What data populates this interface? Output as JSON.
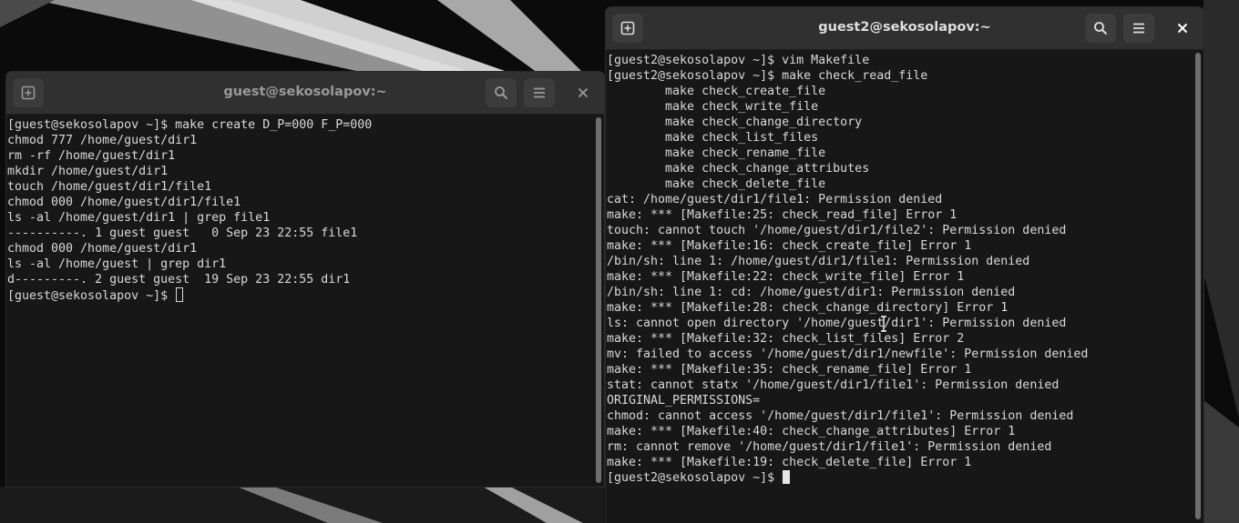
{
  "windows": [
    {
      "id": "term1",
      "title": "guest@sekosolapov:~",
      "buttons": {
        "new_tab": "new-tab-icon",
        "search": "search-icon",
        "menu": "hamburger-menu-icon",
        "close": "close-icon"
      },
      "lines": [
        "[guest@sekosolapov ~]$ make create D_P=000 F_P=000",
        "chmod 777 /home/guest/dir1",
        "rm -rf /home/guest/dir1",
        "mkdir /home/guest/dir1",
        "touch /home/guest/dir1/file1",
        "chmod 000 /home/guest/dir1/file1",
        "ls -al /home/guest/dir1 | grep file1",
        "----------. 1 guest guest   0 Sep 23 22:55 file1",
        "chmod 000 /home/guest/dir1",
        "ls -al /home/guest | grep dir1",
        "d---------. 2 guest guest  19 Sep 23 22:55 dir1"
      ],
      "prompt": "[guest@sekosolapov ~]$ "
    },
    {
      "id": "term2",
      "title": "guest2@sekosolapov:~",
      "buttons": {
        "new_tab": "new-tab-icon",
        "search": "search-icon",
        "menu": "hamburger-menu-icon",
        "close": "close-icon"
      },
      "lines": [
        "[guest2@sekosolapov ~]$ vim Makefile",
        "[guest2@sekosolapov ~]$ make check_read_file",
        "        make check_create_file",
        "        make check_write_file",
        "        make check_change_directory",
        "        make check_list_files",
        "        make check_rename_file",
        "        make check_change_attributes",
        "        make check_delete_file",
        "cat: /home/guest/dir1/file1: Permission denied",
        "make: *** [Makefile:25: check_read_file] Error 1",
        "touch: cannot touch '/home/guest/dir1/file2': Permission denied",
        "make: *** [Makefile:16: check_create_file] Error 1",
        "/bin/sh: line 1: /home/guest/dir1/file1: Permission denied",
        "make: *** [Makefile:22: check_write_file] Error 1",
        "/bin/sh: line 1: cd: /home/guest/dir1: Permission denied",
        "make: *** [Makefile:28: check_change_directory] Error 1",
        "ls: cannot open directory '/home/guest/dir1': Permission denied",
        "make: *** [Makefile:32: check_list_files] Error 2",
        "mv: failed to access '/home/guest/dir1/newfile': Permission denied",
        "make: *** [Makefile:35: check_rename_file] Error 1",
        "stat: cannot statx '/home/guest/dir1/file1': Permission denied",
        "ORIGINAL_PERMISSIONS=",
        "chmod: cannot access '/home/guest/dir1/file1': Permission denied",
        "make: *** [Makefile:40: check_change_attributes] Error 1",
        "rm: cannot remove '/home/guest/dir1/file1': Permission denied",
        "make: *** [Makefile:19: check_delete_file] Error 1"
      ],
      "prompt": "[guest2@sekosolapov ~]$ "
    }
  ]
}
